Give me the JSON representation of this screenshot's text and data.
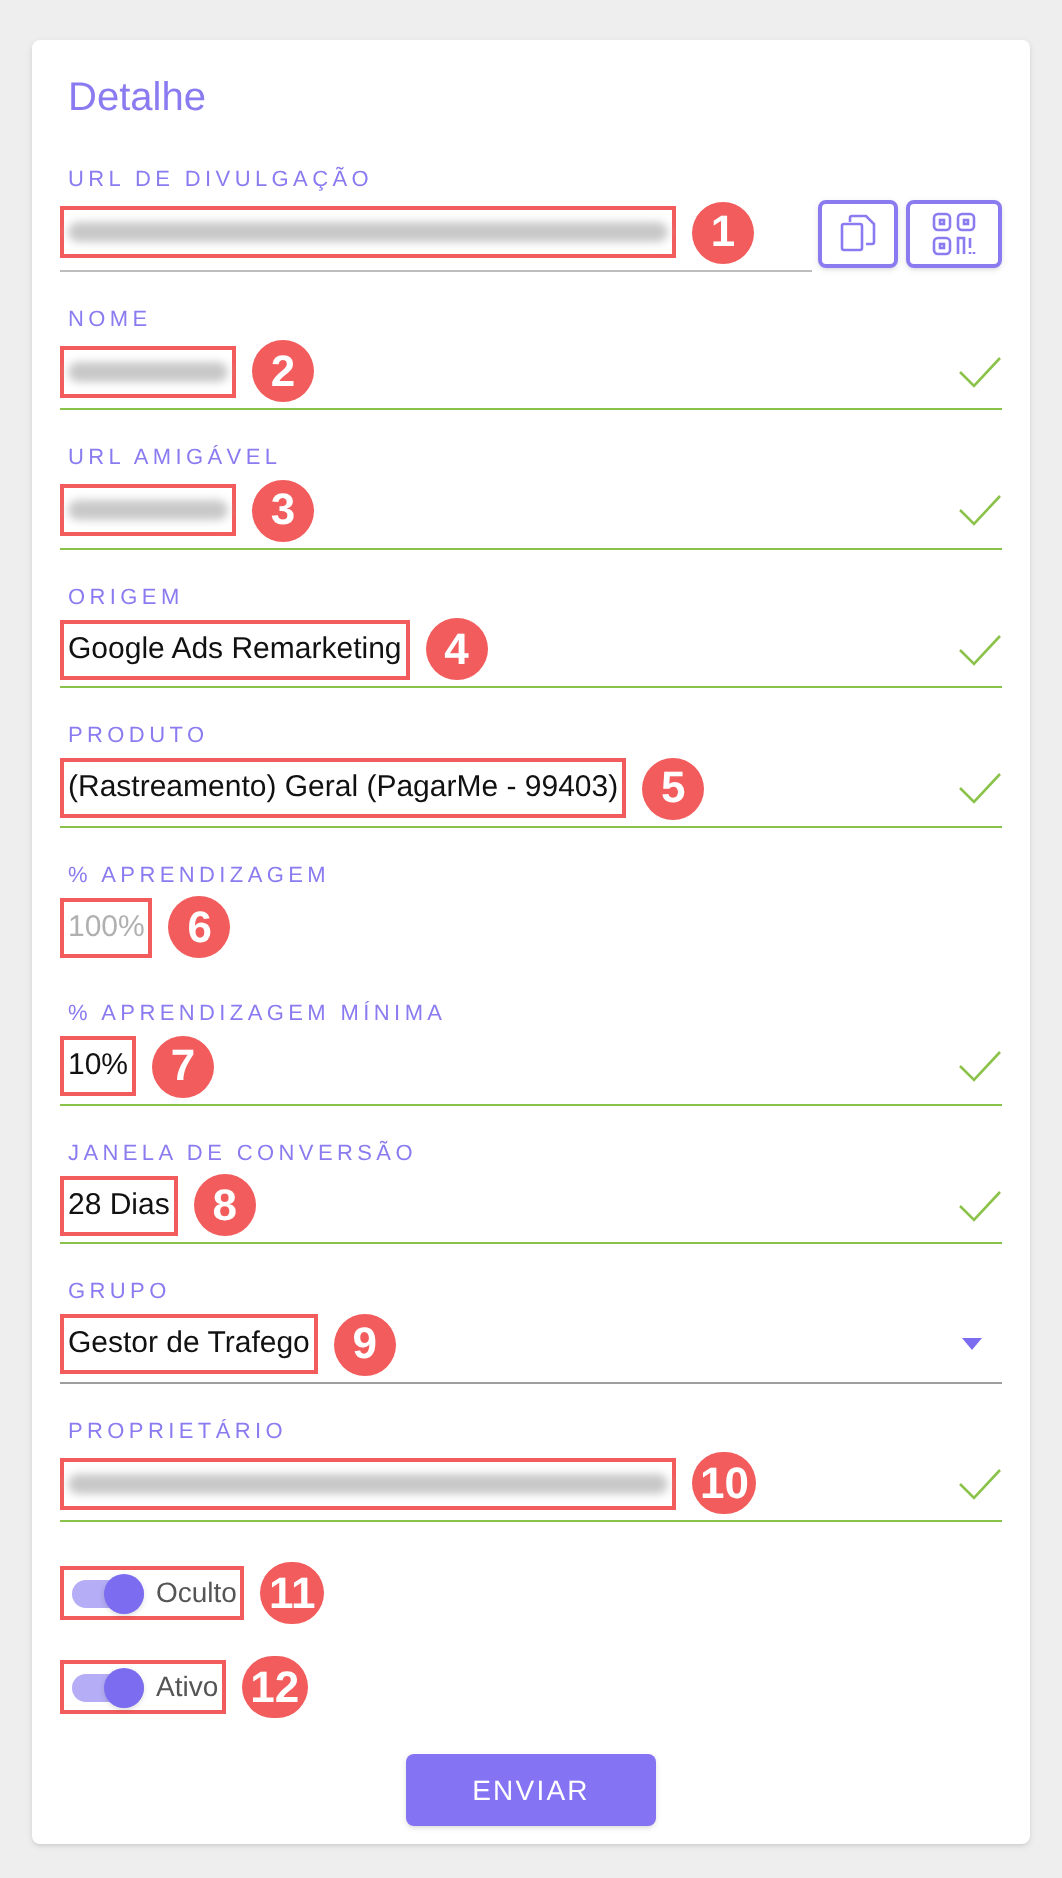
{
  "title": "Detalhe",
  "fields": [
    {
      "label": "URL DE DIVULGAÇÃO",
      "kind": "url",
      "marker": "1"
    },
    {
      "label": "NOME",
      "kind": "secret",
      "valid": true,
      "marker": "2"
    },
    {
      "label": "URL AMIGÁVEL",
      "kind": "secret",
      "valid": true,
      "marker": "3"
    },
    {
      "label": "ORIGEM",
      "kind": "text",
      "value": "Google Ads Remarketing",
      "valid": true,
      "marker": "4"
    },
    {
      "label": "PRODUTO",
      "kind": "text",
      "value": "(Rastreamento) Geral (PagarMe - 99403)",
      "valid": true,
      "marker": "5"
    },
    {
      "label": "% APRENDIZAGEM",
      "kind": "text",
      "value": "100%",
      "disabled": true,
      "valid": false,
      "marker": "6"
    },
    {
      "label": "% APRENDIZAGEM MÍNIMA",
      "kind": "text",
      "value": "10%",
      "valid": true,
      "marker": "7"
    },
    {
      "label": "JANELA DE CONVERSÃO",
      "kind": "text",
      "value": "28 Dias",
      "valid": true,
      "marker": "8"
    },
    {
      "label": "GRUPO",
      "kind": "select",
      "value": "Gestor de Trafego",
      "marker": "9"
    },
    {
      "label": "PROPRIETÁRIO",
      "kind": "secret_long",
      "valid": true,
      "marker": "10"
    }
  ],
  "toggles": [
    {
      "label": "Oculto",
      "on": true,
      "marker": "11"
    },
    {
      "label": "Ativo",
      "on": true,
      "marker": "12"
    }
  ],
  "submit": "ENVIAR"
}
